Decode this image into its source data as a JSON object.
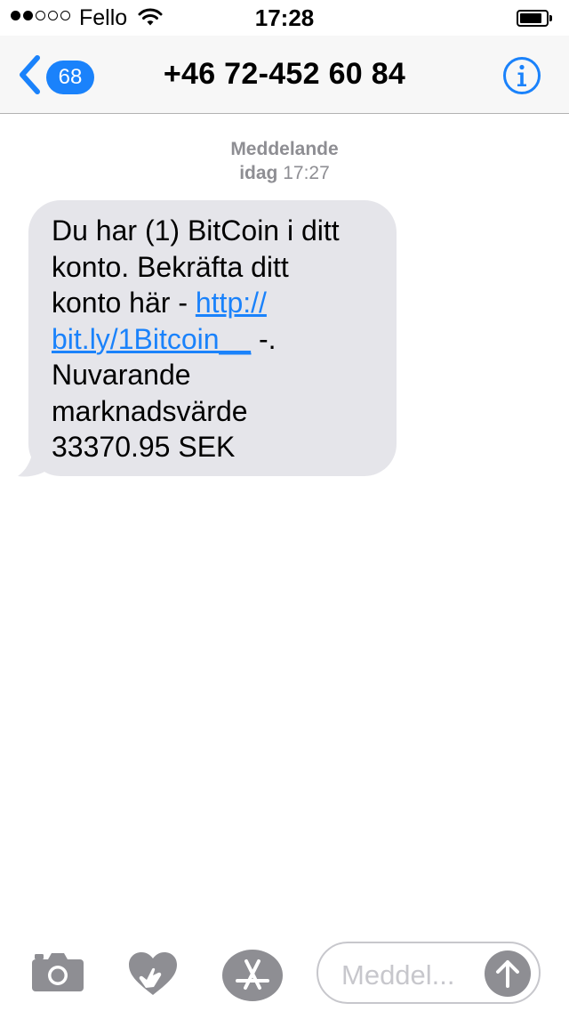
{
  "status_bar": {
    "carrier": "Fello",
    "time": "17:28"
  },
  "nav": {
    "back_badge": "68",
    "title": "+46 72-452 60 84"
  },
  "thread": {
    "service": "Meddelande",
    "date_day": "idag",
    "date_time": "17:27"
  },
  "message": {
    "line1": "Du har (1) BitCoin i ditt",
    "line2": "konto. Bekräfta ditt",
    "line3_text": "konto här - ",
    "link_part1": "http://",
    "link_part2": "bit.ly/1Bitcoin__",
    "line4_suffix": " -.",
    "line5": "Nuvarande",
    "line6": "marknadsvärde",
    "line7": "33370.95 SEK"
  },
  "input": {
    "placeholder": "Meddel..."
  },
  "colors": {
    "accent": "#1a82fb",
    "bubble": "#e5e5ea",
    "meta_text": "#8e8e93",
    "tool_icons": "#8e8e93"
  },
  "icons": {
    "back": "chevron-left-icon",
    "info": "info-icon",
    "camera": "camera-icon",
    "digital_touch": "heart-hand-icon",
    "app_store": "app-store-icon",
    "send": "arrow-up-icon"
  }
}
